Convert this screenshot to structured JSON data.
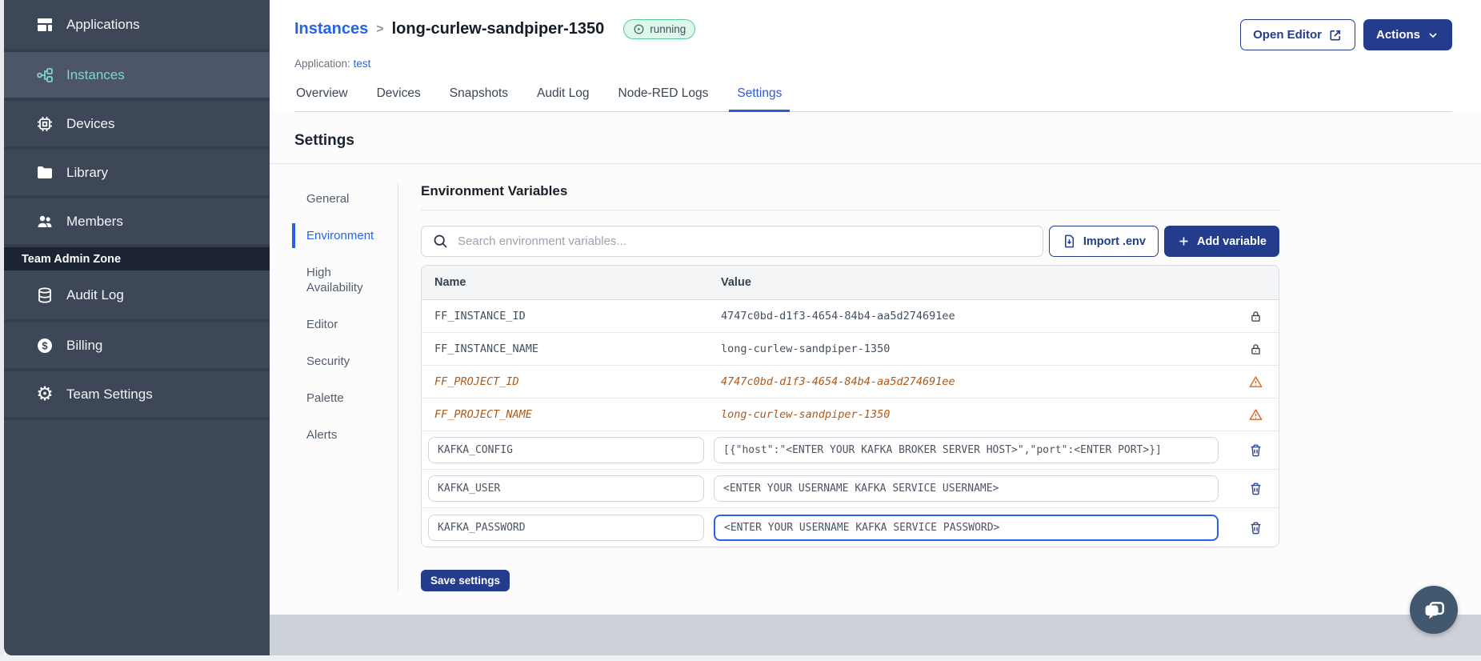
{
  "sidebar": {
    "items": [
      {
        "label": "Applications",
        "active": false
      },
      {
        "label": "Instances",
        "active": true
      },
      {
        "label": "Devices",
        "active": false
      },
      {
        "label": "Library",
        "active": false
      },
      {
        "label": "Members",
        "active": false
      }
    ],
    "section_label": "Team Admin Zone",
    "admin_items": [
      {
        "label": "Audit Log"
      },
      {
        "label": "Billing"
      },
      {
        "label": "Team Settings"
      }
    ]
  },
  "header": {
    "breadcrumb_parent": "Instances",
    "breadcrumb_separator": ">",
    "instance_name": "long-curlew-sandpiper-1350",
    "status_badge": "running",
    "application_label": "Application:",
    "application_name": "test",
    "open_editor_label": "Open Editor",
    "actions_label": "Actions"
  },
  "tabs": {
    "items": [
      "Overview",
      "Devices",
      "Snapshots",
      "Audit Log",
      "Node-RED Logs",
      "Settings"
    ],
    "active": "Settings"
  },
  "settings": {
    "page_title": "Settings",
    "nav": [
      "General",
      "Environment",
      "High Availability",
      "Editor",
      "Security",
      "Palette",
      "Alerts"
    ],
    "nav_active": "Environment",
    "section_title": "Environment Variables",
    "search_placeholder": "Search environment variables...",
    "import_button": "Import .env",
    "add_button": "Add variable",
    "save_button": "Save settings",
    "table": {
      "columns": [
        "Name",
        "Value"
      ],
      "rows": [
        {
          "name": "FF_INSTANCE_ID",
          "value": "4747c0bd-d1f3-4654-84b4-aa5d274691ee",
          "type": "locked"
        },
        {
          "name": "FF_INSTANCE_NAME",
          "value": "long-curlew-sandpiper-1350",
          "type": "locked"
        },
        {
          "name": "FF_PROJECT_ID",
          "value": "4747c0bd-d1f3-4654-84b4-aa5d274691ee",
          "type": "deprecated"
        },
        {
          "name": "FF_PROJECT_NAME",
          "value": "long-curlew-sandpiper-1350",
          "type": "deprecated"
        },
        {
          "name": "KAFKA_CONFIG",
          "value": "[{\"host\":\"<ENTER YOUR KAFKA BROKER SERVER HOST>\",\"port\":<ENTER PORT>}]",
          "type": "editable"
        },
        {
          "name": "KAFKA_USER",
          "value": "<ENTER YOUR USERNAME KAFKA SERVICE USERNAME>",
          "type": "editable"
        },
        {
          "name": "KAFKA_PASSWORD",
          "value": "<ENTER YOUR USERNAME KAFKA SERVICE PASSWORD>",
          "type": "editable",
          "focused": true
        }
      ]
    }
  },
  "colors": {
    "sidebar_bg": "#3e4757",
    "sidebar_active_bg": "#4d5669",
    "teal_accent": "#7ed4d2",
    "link_blue": "#2563eb",
    "active_tab_blue": "#2f5bd9",
    "navy_button": "#243c8c",
    "deprecated_orange": "#ac5a1b",
    "warning_orange": "#d9671d",
    "badge_green_border": "#5cc996",
    "badge_green_bg": "#ddf7ea",
    "footer_gray": "#cdd1d8"
  }
}
